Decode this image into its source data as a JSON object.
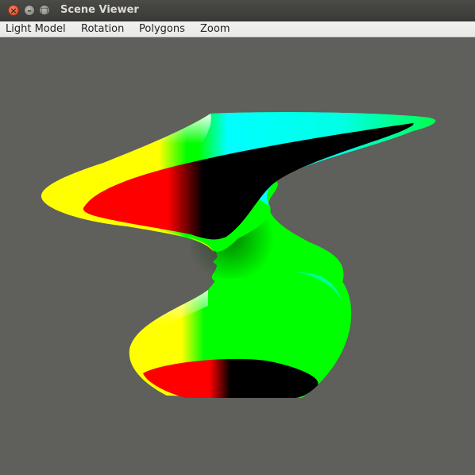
{
  "window": {
    "title": "Scene Viewer",
    "close_glyph": "×",
    "minimize_glyph": "–",
    "maximize_glyph": "□"
  },
  "menu": {
    "items": [
      "Light Model",
      "Rotation",
      "Polygons",
      "Zoom"
    ]
  },
  "scene": {
    "background_color": "#5f5f5b",
    "surface_colors": [
      "#ffff00",
      "#ff0000",
      "#000000",
      "#00ff00",
      "#00ffff",
      "#ffffff"
    ]
  }
}
